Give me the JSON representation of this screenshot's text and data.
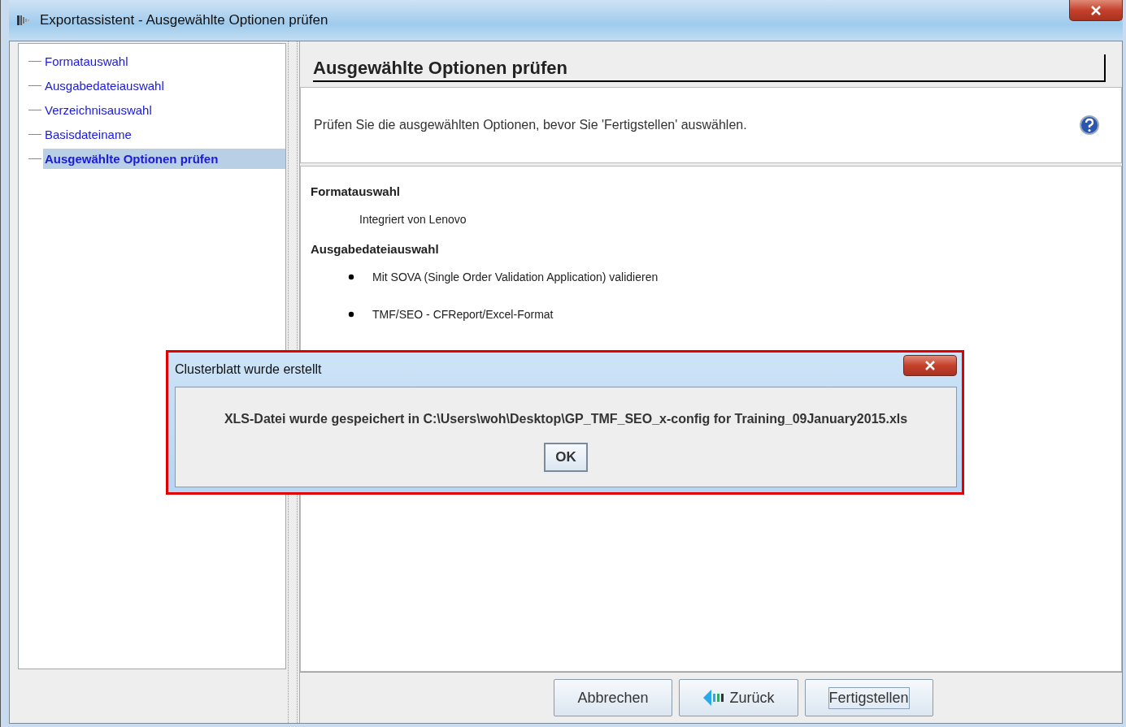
{
  "window": {
    "title": "Exportassistent - Ausgewählte Optionen prüfen"
  },
  "steps": [
    {
      "label": "Formatauswahl",
      "selected": false
    },
    {
      "label": "Ausgabedateiauswahl",
      "selected": false
    },
    {
      "label": "Verzeichnisauswahl",
      "selected": false
    },
    {
      "label": "Basisdateiname",
      "selected": false
    },
    {
      "label": "Ausgewählte Optionen prüfen",
      "selected": true
    }
  ],
  "page": {
    "heading": "Ausgewählte Optionen prüfen",
    "description": "Prüfen Sie die ausgewählten Optionen, bevor Sie 'Fertigstellen' auswählen."
  },
  "summary": [
    {
      "heading": "Formatauswahl",
      "items": [
        {
          "kind": "plain",
          "text": "Integriert von Lenovo"
        }
      ]
    },
    {
      "heading": "Ausgabedateiauswahl",
      "items": [
        {
          "kind": "bullet",
          "text": "Mit SOVA (Single Order Validation Application) validieren"
        },
        {
          "kind": "bullet",
          "text": "TMF/SEO - CFReport/Excel-Format"
        }
      ]
    }
  ],
  "buttons": [
    {
      "label": "Abbrechen",
      "kind": "plain",
      "focused": false
    },
    {
      "label": "Zurück",
      "kind": "back",
      "focused": false
    },
    {
      "label": "Fertigstellen",
      "kind": "plain",
      "focused": true
    }
  ],
  "dialog": {
    "title": "Clusterblatt wurde erstellt",
    "message": "XLS-Datei wurde gespeichert in C:\\Users\\woh\\Desktop\\GP_TMF_SEO_x-config for Training_09January2015.xls",
    "button": "OK"
  }
}
